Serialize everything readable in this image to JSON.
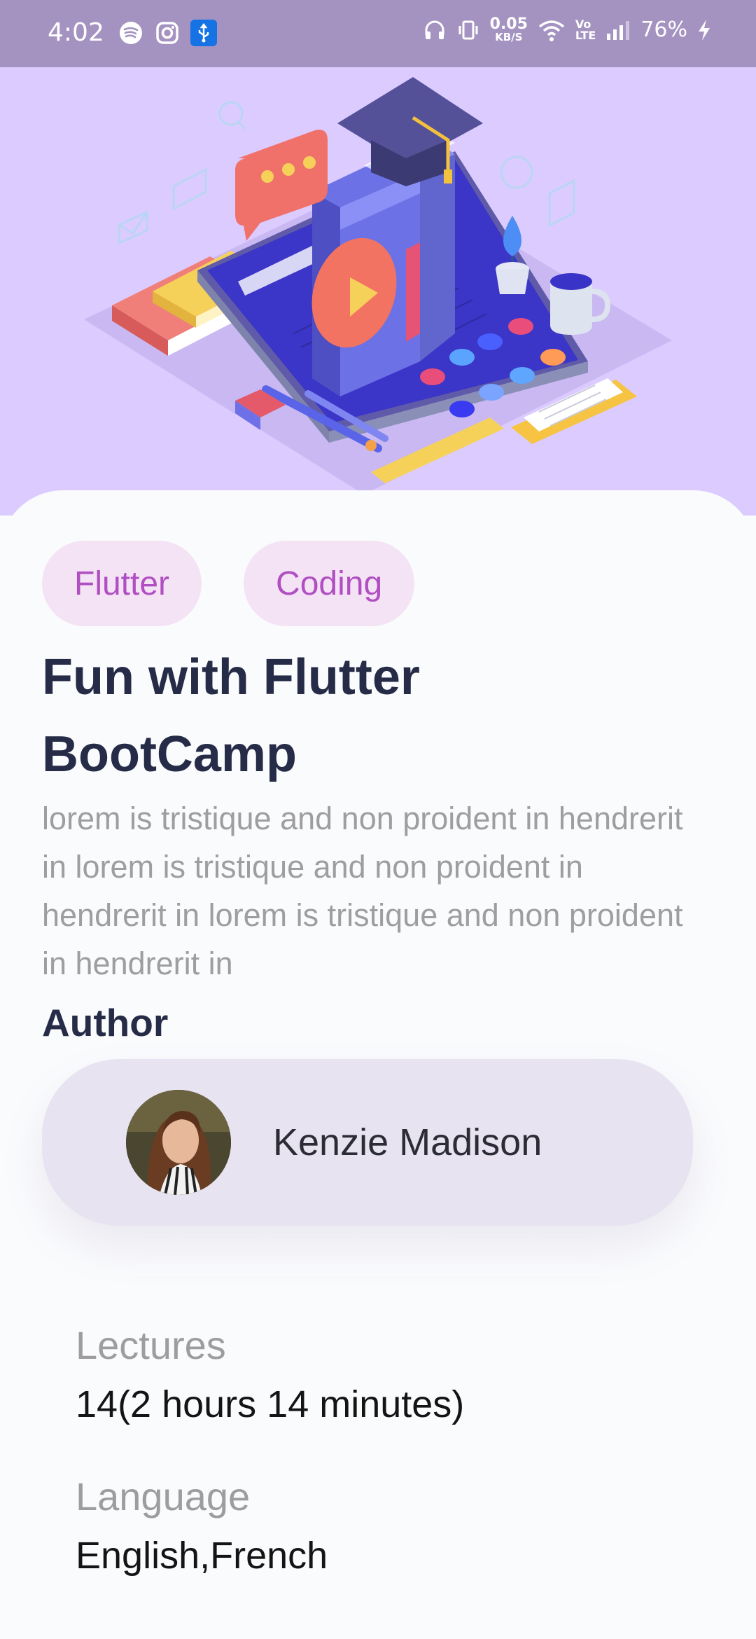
{
  "status_bar": {
    "time": "4:02",
    "left_icons": [
      "spotify-icon",
      "instagram-icon",
      "usb-icon"
    ],
    "speed_value": "0.05",
    "speed_unit": "KB/S",
    "volte_top": "Vo",
    "volte_bottom": "LTE",
    "battery": "76%"
  },
  "course": {
    "tags": [
      "Flutter",
      "Coding"
    ],
    "title": "Fun with Flutter BootCamp",
    "description": "lorem is tristique and non proident in hendrerit in lorem is tristique and non proident in hendrerit in lorem is tristique and non proident in hendrerit in"
  },
  "author": {
    "label": "Author",
    "name": "Kenzie Madison"
  },
  "details": {
    "lectures_label": "Lectures",
    "lectures_value": "14(2 hours 14 minutes)",
    "language_label": "Language",
    "language_value": "English,French"
  },
  "colors": {
    "status_bar": "#a493c1",
    "hero_bg": "#dccbff",
    "chip_bg": "#f4e3f4",
    "chip_text": "#b04fc2",
    "title_text": "#262c47",
    "card_bg": "#e8e3f0"
  }
}
